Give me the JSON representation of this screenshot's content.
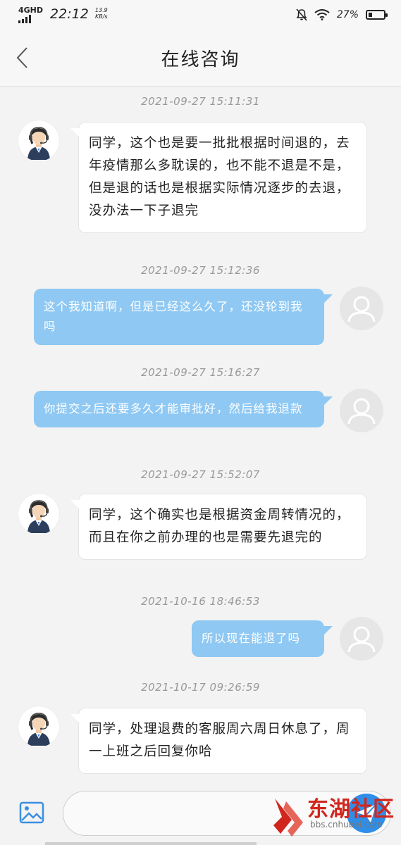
{
  "status_bar": {
    "network": "4GHD",
    "time": "22:12",
    "speed_value": "13.9",
    "speed_unit": "KB/s",
    "battery_percent": "27%",
    "battery_level": 0.27
  },
  "header": {
    "title": "在线咨询"
  },
  "messages": [
    {
      "timestamp": "2021-09-27 15:11:31",
      "from": "agent",
      "text": "同学，这个也是要一批批根据时间退的，去年疫情那么多耽误的，也不能不退是不是，但是退的话也是根据实际情况逐步的去退，没办法一下子退完"
    },
    {
      "timestamp": "2021-09-27 15:12:36",
      "from": "user",
      "text": "这个我知道啊，但是已经这么久了，还没轮到我吗"
    },
    {
      "timestamp": "2021-09-27 15:16:27",
      "from": "user",
      "text": "你提交之后还要多久才能审批好，然后给我退款"
    },
    {
      "timestamp": "2021-09-27 15:52:07",
      "from": "agent",
      "text": "同学，这个确实也是根据资金周转情况的，而且在你之前办理的也是需要先退完的"
    },
    {
      "timestamp": "2021-10-16 18:46:53",
      "from": "user",
      "text": "所以现在能退了吗"
    },
    {
      "timestamp": "2021-10-17 09:26:59",
      "from": "agent",
      "text": "同学，处理退费的客服周六周日休息了，周一上班之后回复你哈"
    }
  ],
  "input": {
    "value": "",
    "placeholder": ""
  },
  "watermark": {
    "name": "东湖社区",
    "url": "bbs.cnhubei.com"
  },
  "icons": {
    "back": "chevron-left-icon",
    "image": "image-icon",
    "send": "send-icon",
    "agent_avatar": "customer-service-avatar",
    "user_avatar": "default-user-avatar"
  },
  "colors": {
    "outgoing_bubble": "#8ec8f3",
    "incoming_bubble": "#ffffff",
    "send_button": "#2f8ee8",
    "watermark_red": "#d1261d"
  }
}
